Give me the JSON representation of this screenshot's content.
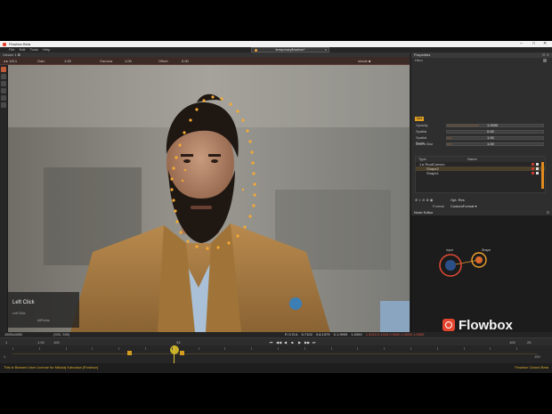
{
  "window": {
    "title": "Flowbox Beta",
    "minimize": "–",
    "maximize": "□",
    "close": "✕"
  },
  "menu": [
    "File",
    "Edit",
    "Tools",
    "Help"
  ],
  "doc_tab": {
    "label": "temporaryflowbox*",
    "close": "×"
  },
  "viewer": {
    "panel_title": "Viewer 1 ⊠",
    "toolbar": {
      "frame": "1/0.1",
      "gain_label": "Gain",
      "gain_value": "1.00",
      "gamma_label": "Gamma",
      "gamma_value": "1.00",
      "offset_label": "Offset",
      "offset_value": "0.00",
      "mode": "shade ■"
    }
  },
  "hint": {
    "title": "Left Click",
    "line1": "Left Click",
    "line2": "AllPoints"
  },
  "properties": {
    "panel_title": "Properties",
    "section": "Hero",
    "tag": "Opa",
    "params": [
      {
        "label": "Opacity",
        "value": "1.0000",
        "fill": 0.33
      },
      {
        "label": "Spatial",
        "value": "0.00",
        "fill": 0.0
      },
      {
        "label": "Spatial Scale",
        "value": "1.00",
        "fill": 0.06
      },
      {
        "label": "Macro Blur",
        "value": "1.00",
        "fill": 0.06
      }
    ],
    "layers": {
      "col_type": "Type",
      "col_name": "Name",
      "rows": [
        {
          "label": "1 ▸ RootConvex"
        },
        {
          "label": "Shape2"
        },
        {
          "label": "Shape1"
        }
      ]
    },
    "transform": {
      "icons": "⊕ ◐ ⊘ ⊗ ◉",
      "option": "Opt. Res",
      "format_label": "Format",
      "format_value": "CustomFormat ▾",
      "width_label": "width",
      "width_value": "0",
      "width_max": "100",
      "height_label": "Height",
      "height_value": "0",
      "height_max": "100",
      "premultiply_label": "premultiply"
    }
  },
  "node_editor": {
    "panel_title": "Node Editor",
    "nodes": [
      {
        "label": "input"
      },
      {
        "label": "Shape"
      }
    ]
  },
  "brand": {
    "word": "Flowbox"
  },
  "status": {
    "left": "1920x1080",
    "info": "(930, 395)",
    "color_label": "R G B A",
    "values": [
      "0.7102",
      "0.8.1979",
      "0.1.9909",
      "1.0000"
    ],
    "extra": "1.2010  0.1024  0.0000  1.0000  1.0000"
  },
  "timeline": {
    "start": "1",
    "in_label": "1.00",
    "speed": "100",
    "frame_label": "33",
    "end_label": "100",
    "fps": "25",
    "transport": [
      "⏮",
      "◀◀",
      "◀",
      "■",
      "▶",
      "▶▶",
      "⏭"
    ],
    "ruler_start": "1",
    "ruler_end": "100",
    "playhead_frame": 33,
    "keyframes": [
      23,
      33
    ]
  },
  "footer": {
    "left": "This is Beaned User License for Mikolaj Kakowsa (Flowbox)",
    "right": "Flowbox Closed Beta"
  }
}
